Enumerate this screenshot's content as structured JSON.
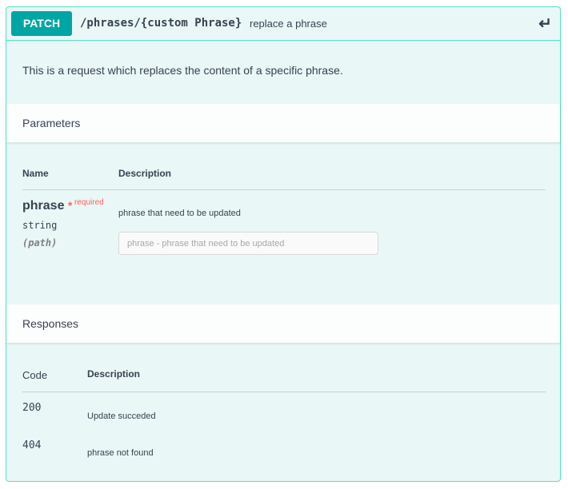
{
  "operation": {
    "method": "PATCH",
    "path": "/phrases/{custom Phrase}",
    "summary": "replace a phrase",
    "description": "This is a request which replaces the content of a specific phrase.",
    "collapse_icon": "return-arrow-icon"
  },
  "parameters": {
    "title": "Parameters",
    "col_name": "Name",
    "col_desc": "Description",
    "items": [
      {
        "name": "phrase",
        "star": "*",
        "required": "required",
        "type": "string",
        "in": "(path)",
        "description": "phrase that need to be updated",
        "placeholder": "phrase - phrase that need to be updated"
      }
    ]
  },
  "responses": {
    "title": "Responses",
    "col_code": "Code",
    "col_desc": "Description",
    "items": [
      {
        "code": "200",
        "description": "Update succeded"
      },
      {
        "code": "404",
        "description": "phrase not found"
      }
    ]
  },
  "colors": {
    "method": "#00a5a5",
    "border": "#50e3c2",
    "background": "#e9f7f6",
    "required": "#ff6060"
  }
}
